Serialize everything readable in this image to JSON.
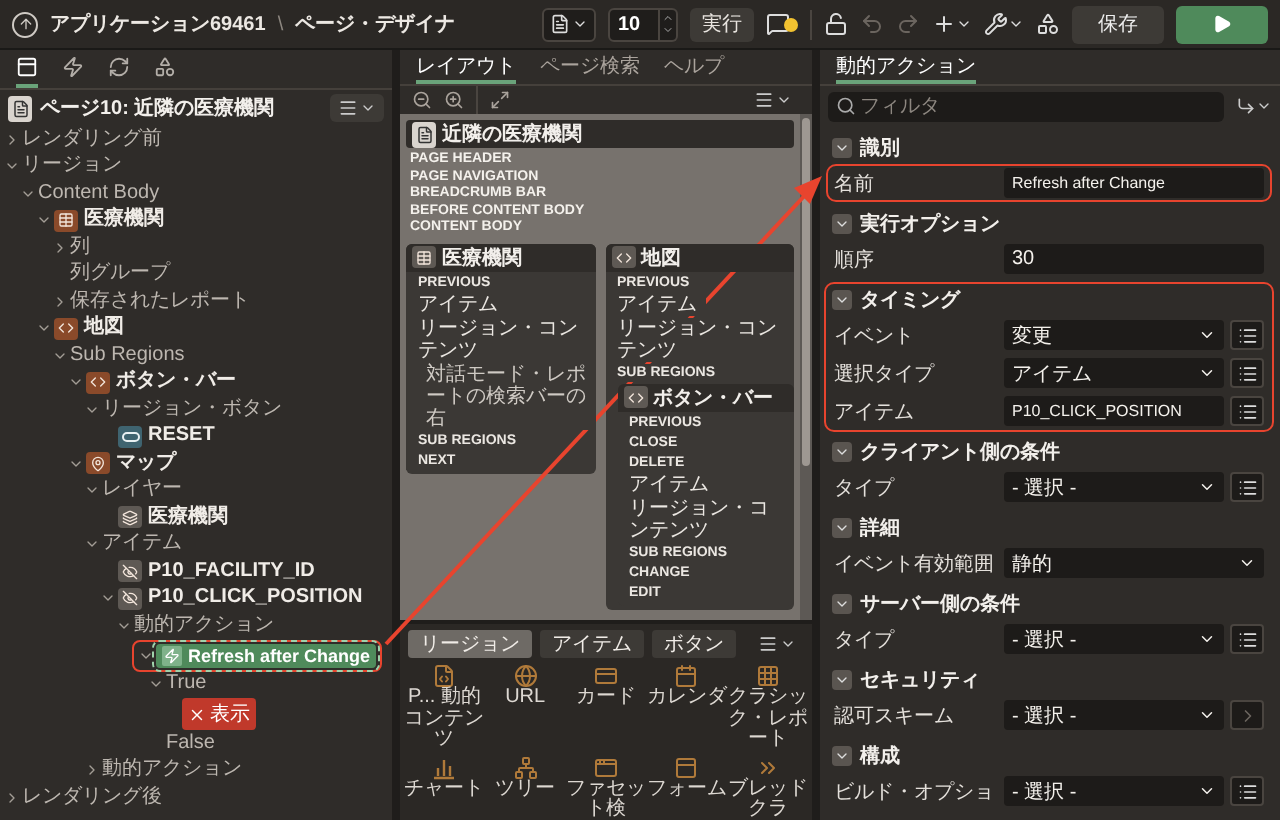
{
  "top_bar": {
    "app": "アプリケーション69461",
    "separator": "\\",
    "page": "ページ・デザイナ",
    "page_number": "10",
    "run": "実行",
    "warning_badge": true,
    "save": "保存",
    "tools": [
      {
        "kind": "lock",
        "disabled": false
      },
      {
        "kind": "undo",
        "disabled": true
      },
      {
        "kind": "redo",
        "disabled": true
      },
      {
        "kind": "add",
        "disabled": false
      },
      {
        "kind": "utilities",
        "disabled": false
      },
      {
        "kind": "shared",
        "disabled": false
      }
    ]
  },
  "tree_tabs": [
    {
      "kind": "rendering",
      "selected": true
    },
    {
      "kind": "dynamic-actions",
      "selected": false
    },
    {
      "kind": "processing",
      "selected": false
    },
    {
      "kind": "shared",
      "selected": false
    }
  ],
  "page_label": "ページ10: 近隣の医療機関",
  "tree": [
    {
      "label": "レンダリング前",
      "kind": "group",
      "expanded": false,
      "selected": false
    },
    {
      "label": "リージョン",
      "kind": "group",
      "expanded": true,
      "selected": false,
      "children": [
        {
          "label": "Content Body",
          "kind": "group",
          "expanded": true,
          "selected": false,
          "children": [
            {
              "label": "医療機関",
              "kind": "report-region",
              "expanded": true,
              "selected": false,
              "children": [
                {
                  "label": "列",
                  "kind": "group",
                  "expanded": false,
                  "selected": false
                },
                {
                  "label": "列グループ",
                  "kind": "group",
                  "selected": false
                },
                {
                  "label": "保存されたレポート",
                  "kind": "group",
                  "expanded": false,
                  "selected": false
                }
              ]
            },
            {
              "label": "地図",
              "kind": "static-region",
              "expanded": true,
              "selected": false,
              "children": [
                {
                  "label": "Sub Regions",
                  "kind": "group",
                  "expanded": true,
                  "selected": false,
                  "children": [
                    {
                      "label": "ボタン・バー",
                      "kind": "static-region",
                      "expanded": true,
                      "selected": false,
                      "children": [
                        {
                          "label": "リージョン・ボタン",
                          "kind": "group",
                          "expanded": true,
                          "selected": false,
                          "children": [
                            {
                              "label": "RESET",
                              "kind": "button",
                              "selected": false
                            }
                          ]
                        }
                      ]
                    },
                    {
                      "label": "マップ",
                      "kind": "map-region",
                      "expanded": true,
                      "selected": false,
                      "children": [
                        {
                          "label": "レイヤー",
                          "kind": "group",
                          "expanded": true,
                          "selected": false,
                          "children": [
                            {
                              "label": "医療機関",
                              "kind": "layer",
                              "selected": false
                            }
                          ]
                        },
                        {
                          "label": "アイテム",
                          "kind": "group",
                          "expanded": true,
                          "selected": false,
                          "children": [
                            {
                              "label": "P10_FACILITY_ID",
                              "kind": "hidden-item",
                              "selected": false
                            },
                            {
                              "label": "P10_CLICK_POSITION",
                              "kind": "hidden-item",
                              "expanded": true,
                              "selected": false,
                              "children": [
                                {
                                  "label": "動的アクション",
                                  "kind": "group",
                                  "expanded": true,
                                  "selected": false,
                                  "children": [
                                    {
                                      "label": "Refresh after Change",
                                      "kind": "dynamic-action",
                                      "expanded": true,
                                      "selected": true,
                                      "highlighted": true,
                                      "children": [
                                        {
                                          "label": "True",
                                          "kind": "branch",
                                          "expanded": true,
                                          "selected": false,
                                          "children": [
                                            {
                                              "label": "表示",
                                              "kind": "action",
                                              "selected": false
                                            }
                                          ]
                                        },
                                        {
                                          "label": "False",
                                          "kind": "branch",
                                          "selected": false
                                        }
                                      ]
                                    }
                                  ]
                                }
                              ]
                            }
                          ]
                        },
                        {
                          "label": "動的アクション",
                          "kind": "group",
                          "expanded": false,
                          "selected": false
                        }
                      ]
                    }
                  ]
                }
              ]
            }
          ]
        }
      ]
    },
    {
      "label": "レンダリング後",
      "kind": "group",
      "expanded": false,
      "selected": false
    }
  ],
  "center_tabs": [
    {
      "label": "レイアウト",
      "selected": true
    },
    {
      "label": "ページ検索",
      "selected": false
    },
    {
      "label": "ヘルプ",
      "selected": false
    }
  ],
  "layout": {
    "page_title": "近隣の医療機関",
    "positions": [
      "PAGE HEADER",
      "PAGE NAVIGATION",
      "BREADCRUMB BAR",
      "BEFORE CONTENT BODY",
      "CONTENT BODY"
    ],
    "regions": [
      {
        "title": "医療機関",
        "kind": "report",
        "slots": [
          {
            "label": "PREVIOUS",
            "kind": "slot"
          },
          {
            "label": "アイテム",
            "kind": "slot"
          },
          {
            "label": "リージョン・コンテンツ",
            "kind": "slot"
          },
          {
            "label": "対話モード・レポートの検索バーの右",
            "kind": "note"
          },
          {
            "label": "SUB REGIONS",
            "kind": "slot"
          },
          {
            "label": "NEXT",
            "kind": "slot"
          }
        ]
      },
      {
        "title": "地図",
        "kind": "static",
        "slots": [
          {
            "label": "PREVIOUS",
            "kind": "slot"
          },
          {
            "label": "アイテム",
            "kind": "slot"
          },
          {
            "label": "リージョン・コンテンツ",
            "kind": "slot"
          },
          {
            "label": "SUB REGIONS",
            "kind": "slot"
          }
        ],
        "sub_regions": [
          {
            "title": "ボタン・バー",
            "kind": "static",
            "slots": [
              {
                "label": "PREVIOUS",
                "kind": "slot"
              },
              {
                "label": "CLOSE",
                "kind": "slot"
              },
              {
                "label": "DELETE",
                "kind": "slot"
              },
              {
                "label": "アイテム",
                "kind": "slot"
              },
              {
                "label": "リージョン・コンテンツ",
                "kind": "slot"
              },
              {
                "label": "SUB REGIONS",
                "kind": "slot"
              },
              {
                "label": "CHANGE",
                "kind": "slot"
              },
              {
                "label": "EDIT",
                "kind": "slot"
              }
            ]
          }
        ]
      }
    ]
  },
  "palette": {
    "tabs": [
      {
        "label": "リージョン",
        "selected": true
      },
      {
        "label": "アイテム",
        "selected": false
      },
      {
        "label": "ボタン",
        "selected": false
      }
    ],
    "items": [
      {
        "label": "P... 動的コンテンツ",
        "kind": "dynamic-content"
      },
      {
        "label": "URL",
        "kind": "url"
      },
      {
        "label": "カード",
        "kind": "cards"
      },
      {
        "label": "カレンダ",
        "kind": "calendar"
      },
      {
        "label": "クラシック・レポート",
        "kind": "report"
      },
      {
        "label": "チャート",
        "kind": "chart"
      },
      {
        "label": "ツリー",
        "kind": "tree"
      },
      {
        "label": "ファセット検",
        "kind": "facet"
      },
      {
        "label": "フォーム",
        "kind": "form"
      },
      {
        "label": "ブレッドクラ",
        "kind": "breadcrumb"
      }
    ]
  },
  "property_tabs": [
    {
      "label": "動的アクション",
      "selected": true
    }
  ],
  "filter": {
    "placeholder": "フィルタ"
  },
  "sections": [
    {
      "title": "識別",
      "expanded": true,
      "rows": [
        {
          "label": "名前",
          "kind": "text",
          "value": "Refresh after Change",
          "highlighted": true
        }
      ]
    },
    {
      "title": "実行オプション",
      "expanded": true,
      "rows": [
        {
          "label": "順序",
          "kind": "text",
          "value": "30"
        }
      ]
    },
    {
      "title": "タイミング",
      "expanded": true,
      "highlighted": true,
      "rows": [
        {
          "label": "イベント",
          "kind": "select",
          "value": "変更",
          "button": {
            "kind": "list"
          }
        },
        {
          "label": "選択タイプ",
          "kind": "select",
          "value": "アイテム",
          "button": {
            "kind": "list"
          }
        },
        {
          "label": "アイテム",
          "kind": "text",
          "value": "P10_CLICK_POSITION",
          "button": {
            "kind": "list"
          }
        }
      ]
    },
    {
      "title": "クライアント側の条件",
      "expanded": true,
      "rows": [
        {
          "label": "タイプ",
          "kind": "select",
          "value": "- 選択 -",
          "button": {
            "kind": "list"
          }
        }
      ]
    },
    {
      "title": "詳細",
      "expanded": true,
      "rows": [
        {
          "label": "イベント有効範囲",
          "kind": "select",
          "value": "静的"
        }
      ]
    },
    {
      "title": "サーバー側の条件",
      "expanded": true,
      "rows": [
        {
          "label": "タイプ",
          "kind": "select",
          "value": "- 選択 -",
          "button": {
            "kind": "list"
          }
        }
      ]
    },
    {
      "title": "セキュリティ",
      "expanded": true,
      "rows": [
        {
          "label": "認可スキーム",
          "kind": "select",
          "value": "- 選択 -",
          "button": {
            "kind": "arrow"
          }
        }
      ]
    },
    {
      "title": "構成",
      "expanded": true,
      "rows": [
        {
          "label": "ビルド・オプショ",
          "kind": "select",
          "value": "- 選択 -",
          "button": {
            "kind": "list"
          }
        }
      ]
    }
  ],
  "callout_arrow": true
}
